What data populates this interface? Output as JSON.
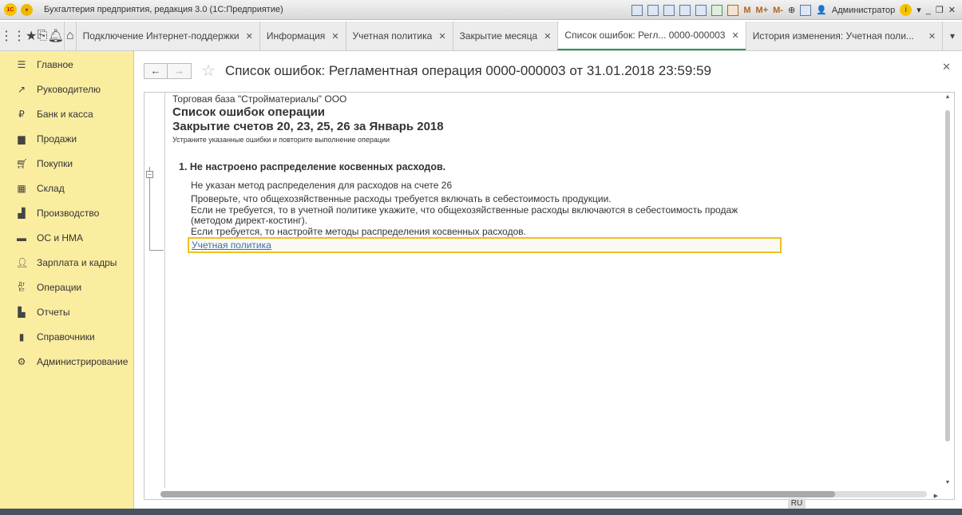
{
  "window": {
    "title": "Бухгалтерия предприятия, редакция 3.0 (1С:Предприятие)",
    "logo": "1С",
    "user": "Администратор",
    "toolbar_m": [
      "M",
      "M+",
      "M-"
    ]
  },
  "tabs": [
    {
      "label": "Подключение Интернет-поддержки"
    },
    {
      "label": "Информация"
    },
    {
      "label": "Учетная политика"
    },
    {
      "label": "Закрытие месяца"
    },
    {
      "label": "Список ошибок: Регл... 0000-000003",
      "active": true
    },
    {
      "label": "История изменения: Учетная поли..."
    }
  ],
  "sidebar": {
    "items": [
      {
        "label": "Главное",
        "icon": "menu-icon"
      },
      {
        "label": "Руководителю",
        "icon": "trend-icon"
      },
      {
        "label": "Банк и касса",
        "icon": "ruble-icon"
      },
      {
        "label": "Продажи",
        "icon": "bag-icon"
      },
      {
        "label": "Покупки",
        "icon": "cart-icon"
      },
      {
        "label": "Склад",
        "icon": "warehouse-icon"
      },
      {
        "label": "Производство",
        "icon": "factory-icon"
      },
      {
        "label": "ОС и НМА",
        "icon": "truck-icon"
      },
      {
        "label": "Зарплата и кадры",
        "icon": "person-icon"
      },
      {
        "label": "Операции",
        "icon": "dt-kt-icon"
      },
      {
        "label": "Отчеты",
        "icon": "bar-chart-icon"
      },
      {
        "label": "Справочники",
        "icon": "book-icon"
      },
      {
        "label": "Администрирование",
        "icon": "gear-icon"
      }
    ]
  },
  "form": {
    "title": "Список ошибок: Регламентная операция 0000-000003 от 31.01.2018 23:59:59"
  },
  "report": {
    "org": "Торговая база \"Стройматериалы\" ООО",
    "heading": "Список ошибок операции",
    "subheading": "Закрытие счетов 20, 23, 25, 26 за Январь 2018",
    "instruction": "Устраните указанные ошибки и повторите выполнение операции",
    "error_title": "1. Не настроено распределение косвенных расходов.",
    "lines": [
      "Не указан метод распределения для расходов на счете 26",
      "Проверьте, что общехозяйственные расходы требуется включать в себестоимость продукции.",
      "Если не требуется, то в учетной политике укажите, что общехозяйственные расходы включаются в себестоимость продаж",
      "(методом директ-костинг).",
      "Если требуется, то настройте методы распределения косвенных расходов."
    ],
    "link": "Учетная политика"
  },
  "status": {
    "lang": "RU"
  },
  "colors": {
    "sidebar": "#fbeda0",
    "active_tab": "#2a9a5a",
    "highlight": "#f0c020",
    "link": "#3a6fb0"
  }
}
